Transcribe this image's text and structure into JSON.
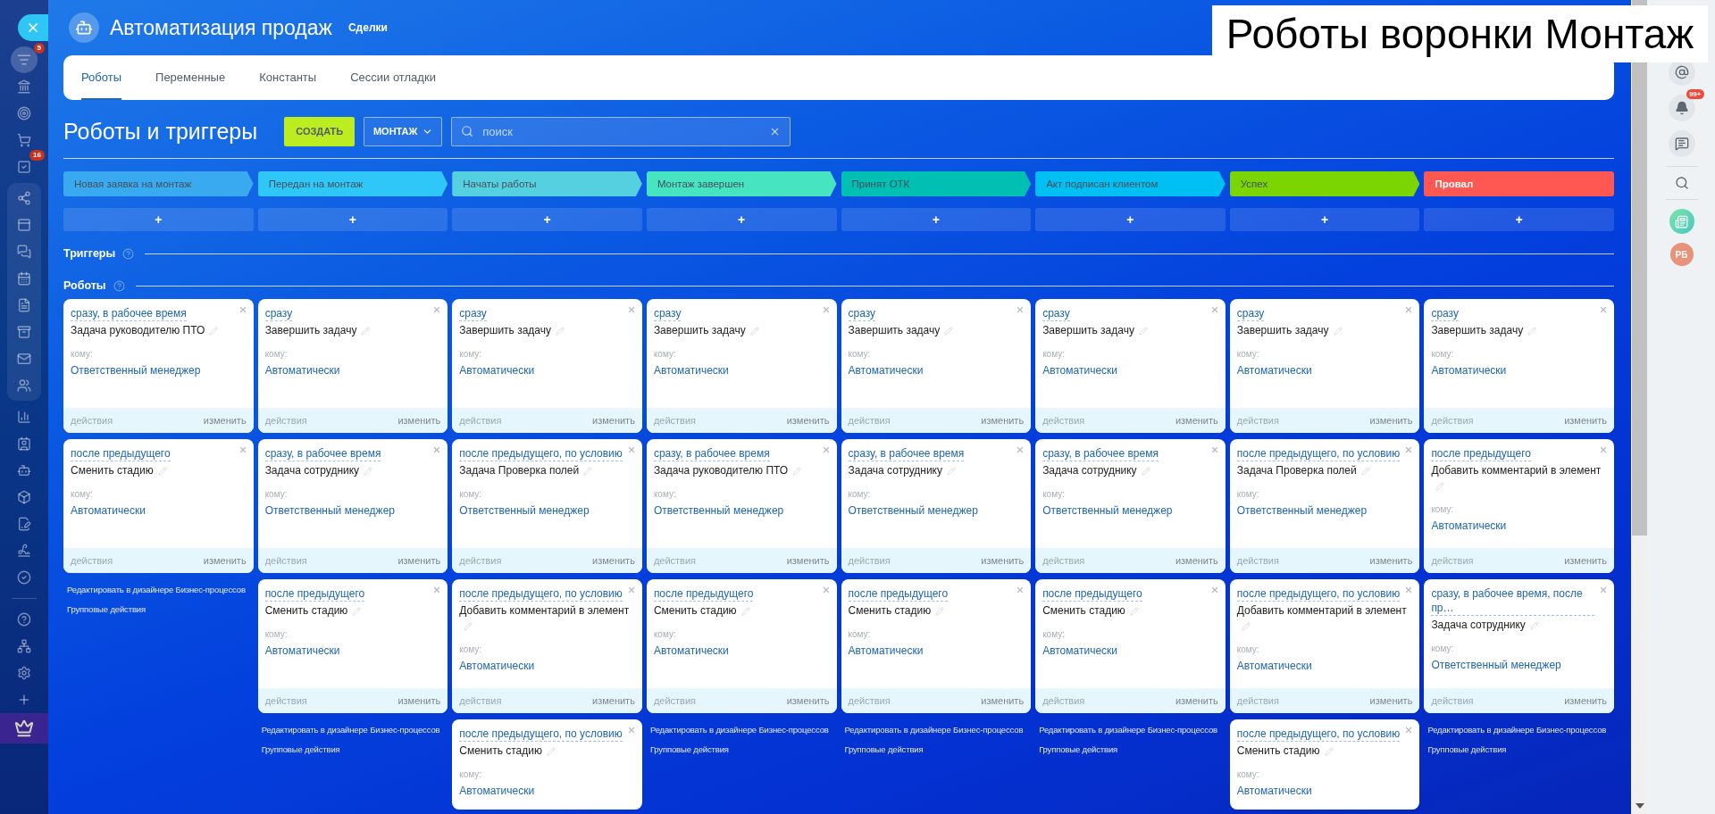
{
  "caption": "Роботы воронки Монтаж",
  "sidebar": {
    "items": [
      {
        "selected": true,
        "badge": "5"
      },
      {
        "selected": false
      },
      {
        "selected": false
      },
      {
        "selected": false
      },
      {
        "selected": false,
        "badge": "16"
      },
      {
        "selected": false
      },
      {
        "selected": false
      },
      {
        "selected": false
      },
      {
        "selected": false
      },
      {
        "selected": false
      },
      {
        "selected": false
      },
      {
        "selected": false
      },
      {
        "selected": false
      },
      {
        "selected": false
      },
      {
        "selected": false
      },
      {
        "selected": false
      },
      {
        "selected": false
      },
      {
        "selected": false
      },
      {
        "selected": false
      },
      {
        "selected": false
      },
      {
        "selected": false
      },
      {
        "selected": false
      },
      {
        "selected": false
      },
      {
        "selected": false
      },
      {
        "selected": false,
        "kind": "upgrade"
      }
    ]
  },
  "header": {
    "title": "Автоматизация продаж",
    "subtitle": "Сделки"
  },
  "tabs": [
    {
      "label": "Роботы",
      "selected": true
    },
    {
      "label": "Переменные",
      "selected": false
    },
    {
      "label": "Константы",
      "selected": false
    },
    {
      "label": "Сессии отладки",
      "selected": false
    }
  ],
  "toolbar": {
    "title": "Роботы и триггеры",
    "create_button": "СОЗДАТЬ",
    "funnel_dropdown": "МОНТАЖ",
    "search": {
      "placeholder": "поиск"
    }
  },
  "stages": [
    {
      "name": "Новая заявка на монтаж",
      "color": "#39a9f0",
      "kind": "process",
      "add": "+"
    },
    {
      "name": "Передан на монтаж",
      "color": "#2fc7f7",
      "kind": "process",
      "add": "+"
    },
    {
      "name": "Начаты работы",
      "color": "#55d0e0",
      "kind": "process",
      "add": "+"
    },
    {
      "name": "Монтаж завершен",
      "color": "#47e4c2",
      "kind": "process",
      "add": "+"
    },
    {
      "name": "Принят ОТК",
      "color": "#00bfb3",
      "kind": "process",
      "add": "+"
    },
    {
      "name": "Акт подписан клиентом",
      "color": "#00bff3",
      "kind": "process",
      "add": "+"
    },
    {
      "name": "Успех",
      "color": "#7bd500",
      "kind": "process",
      "add": "+"
    },
    {
      "name": "Провал",
      "color": "#ff5752",
      "kind": "failure",
      "add": "+"
    }
  ],
  "sections": [
    {
      "title": "Триггеры"
    },
    {
      "title": "Роботы"
    }
  ],
  "columns": [
    {
      "robots": [
        {
          "trigger": "сразу, в рабочее время",
          "title": "Задача руководителю ПТО",
          "to_label": "кому:",
          "to": "Ответственный менеджер",
          "actions": "действия",
          "edit": "изменить"
        },
        {
          "trigger": "после предыдущего",
          "title": "Сменить стадию",
          "to_label": "кому:",
          "to": "Автоматически",
          "actions": "действия",
          "edit": "изменить"
        }
      ],
      "links": [
        "Редактировать в дизайнере Бизнес-процессов",
        "Групповые действия"
      ]
    },
    {
      "robots": [
        {
          "trigger": "сразу",
          "title": "Завершить задачу",
          "to_label": "кому:",
          "to": "Автоматически",
          "actions": "действия",
          "edit": "изменить"
        },
        {
          "trigger": "сразу, в рабочее время",
          "title": "Задача сотруднику",
          "to_label": "кому:",
          "to": "Ответственный менеджер",
          "actions": "действия",
          "edit": "изменить"
        },
        {
          "trigger": "после предыдущего",
          "title": "Сменить стадию",
          "to_label": "кому:",
          "to": "Автоматически",
          "actions": "действия",
          "edit": "изменить"
        }
      ],
      "links": [
        "Редактировать в дизайнере Бизнес-процессов",
        "Групповые действия"
      ]
    },
    {
      "robots": [
        {
          "trigger": "сразу",
          "title": "Завершить задачу",
          "to_label": "кому:",
          "to": "Автоматически",
          "actions": "действия",
          "edit": "изменить"
        },
        {
          "trigger": "после предыдущего, по условию",
          "title": "Задача Проверка полей",
          "to_label": "кому:",
          "to": "Ответственный менеджер",
          "actions": "действия",
          "edit": "изменить"
        },
        {
          "trigger": "после предыдущего, по условию",
          "title": "Добавить комментарий в элемент",
          "to_label": "кому:",
          "to": "Автоматически",
          "actions": "действия",
          "edit": "изменить"
        },
        {
          "trigger": "после предыдущего, по условию",
          "title": "Сменить стадию",
          "to_label": "кому:",
          "to": "Автоматически"
        }
      ]
    },
    {
      "robots": [
        {
          "trigger": "сразу",
          "title": "Завершить задачу",
          "to_label": "кому:",
          "to": "Автоматически",
          "actions": "действия",
          "edit": "изменить"
        },
        {
          "trigger": "сразу, в рабочее время",
          "title": "Задача руководителю ПТО",
          "to_label": "кому:",
          "to": "Ответственный менеджер",
          "actions": "действия",
          "edit": "изменить"
        },
        {
          "trigger": "после предыдущего",
          "title": "Сменить стадию",
          "to_label": "кому:",
          "to": "Автоматически",
          "actions": "действия",
          "edit": "изменить"
        }
      ],
      "links": [
        "Редактировать в дизайнере Бизнес-процессов",
        "Групповые действия"
      ]
    },
    {
      "robots": [
        {
          "trigger": "сразу",
          "title": "Завершить задачу",
          "to_label": "кому:",
          "to": "Автоматически",
          "actions": "действия",
          "edit": "изменить"
        },
        {
          "trigger": "сразу, в рабочее время",
          "title": "Задача сотруднику",
          "to_label": "кому:",
          "to": "Ответственный менеджер",
          "actions": "действия",
          "edit": "изменить"
        },
        {
          "trigger": "после предыдущего",
          "title": "Сменить стадию",
          "to_label": "кому:",
          "to": "Автоматически",
          "actions": "действия",
          "edit": "изменить"
        }
      ],
      "links": [
        "Редактировать в дизайнере Бизнес-процессов",
        "Групповые действия"
      ]
    },
    {
      "robots": [
        {
          "trigger": "сразу",
          "title": "Завершить задачу",
          "to_label": "кому:",
          "to": "Автоматически",
          "actions": "действия",
          "edit": "изменить"
        },
        {
          "trigger": "сразу, в рабочее время",
          "title": "Задача сотруднику",
          "to_label": "кому:",
          "to": "Ответственный менеджер",
          "actions": "действия",
          "edit": "изменить"
        },
        {
          "trigger": "после предыдущего",
          "title": "Сменить стадию",
          "to_label": "кому:",
          "to": "Автоматически",
          "actions": "действия",
          "edit": "изменить"
        }
      ],
      "links": [
        "Редактировать в дизайнере Бизнес-процессов",
        "Групповые действия"
      ]
    },
    {
      "robots": [
        {
          "trigger": "сразу",
          "title": "Завершить задачу",
          "to_label": "кому:",
          "to": "Автоматически",
          "actions": "действия",
          "edit": "изменить"
        },
        {
          "trigger": "после предыдущего, по условию",
          "title": "Задача Проверка полей",
          "to_label": "кому:",
          "to": "Ответственный менеджер",
          "actions": "действия",
          "edit": "изменить"
        },
        {
          "trigger": "после предыдущего, по условию",
          "title": "Добавить комментарий в элемент",
          "to_label": "кому:",
          "to": "Автоматически",
          "actions": "действия",
          "edit": "изменить"
        },
        {
          "trigger": "после предыдущего, по условию",
          "title": "Сменить стадию",
          "to_label": "кому:",
          "to": "Автоматически"
        }
      ]
    },
    {
      "robots": [
        {
          "trigger": "сразу",
          "title": "Завершить задачу",
          "to_label": "кому:",
          "to": "Автоматически",
          "actions": "действия",
          "edit": "изменить"
        },
        {
          "trigger": "после предыдущего",
          "title": "Добавить комментарий в элемент",
          "to_label": "кому:",
          "to": "Автоматически",
          "actions": "действия",
          "edit": "изменить"
        },
        {
          "trigger": "сразу, в рабочее время, после пр…",
          "title": "Задача сотруднику",
          "to_label": "кому:",
          "to": "Ответственный менеджер",
          "actions": "действия",
          "edit": "изменить"
        }
      ],
      "links": [
        "Редактировать в дизайнере Бизнес-процессов",
        "Групповые действия"
      ]
    }
  ],
  "right_panel": {
    "notifications_badge": "99+",
    "avatar": "РБ"
  }
}
